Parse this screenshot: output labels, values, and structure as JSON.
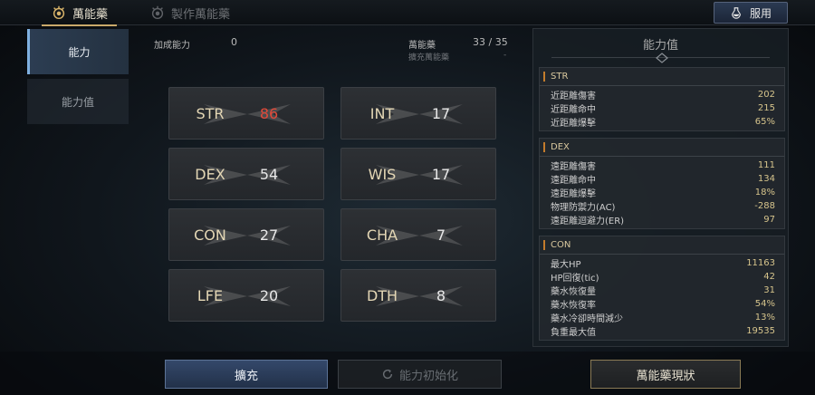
{
  "tabs": [
    {
      "label": "萬能藥",
      "active": true,
      "icon": "elixir-emblem-icon"
    },
    {
      "label": "製作萬能藥",
      "active": false,
      "icon": "craft-emblem-icon"
    }
  ],
  "use_button": {
    "label": "服用",
    "icon": "potion-icon"
  },
  "sidenav": [
    {
      "label": "能力",
      "active": true
    },
    {
      "label": "能力值",
      "active": false
    }
  ],
  "info": {
    "bonus_label": "加成能力",
    "bonus_value": "0",
    "elixir_label": "萬能藥",
    "elixir_value": "33 / 35",
    "expand_label": "擴充萬能藥",
    "expand_value": "-"
  },
  "stats": [
    {
      "name": "STR",
      "value": "86",
      "highlight": true
    },
    {
      "name": "INT",
      "value": "17",
      "highlight": false
    },
    {
      "name": "DEX",
      "value": "54",
      "highlight": false
    },
    {
      "name": "WIS",
      "value": "17",
      "highlight": false
    },
    {
      "name": "CON",
      "value": "27",
      "highlight": false
    },
    {
      "name": "CHA",
      "value": "7",
      "highlight": false
    },
    {
      "name": "LFE",
      "value": "20",
      "highlight": false
    },
    {
      "name": "DTH",
      "value": "8",
      "highlight": false
    }
  ],
  "panel": {
    "title": "能力值",
    "sections": [
      {
        "header": "STR",
        "rows": [
          {
            "label": "近距離傷害",
            "value": "202"
          },
          {
            "label": "近距離命中",
            "value": "215"
          },
          {
            "label": "近距離爆擊",
            "value": "65%"
          }
        ]
      },
      {
        "header": "DEX",
        "rows": [
          {
            "label": "遠距離傷害",
            "value": "111"
          },
          {
            "label": "遠距離命中",
            "value": "134"
          },
          {
            "label": "遠距離爆擊",
            "value": "18%"
          },
          {
            "label": "物理防禦力(AC)",
            "value": "-288"
          },
          {
            "label": "遠距離迴避力(ER)",
            "value": "97"
          }
        ]
      },
      {
        "header": "CON",
        "rows": [
          {
            "label": "最大HP",
            "value": "11163"
          },
          {
            "label": "HP回復(tic)",
            "value": "42"
          },
          {
            "label": "藥水恢復量",
            "value": "31"
          },
          {
            "label": "藥水恢復率",
            "value": "54%"
          },
          {
            "label": "藥水冷卻時間減少",
            "value": "13%"
          },
          {
            "label": "負重最大值",
            "value": "19535"
          }
        ]
      }
    ]
  },
  "buttons": {
    "expand": "擴充",
    "reset": "能力初始化",
    "status": "萬能藥現狀"
  },
  "colors": {
    "accent_gold": "#c9a96a",
    "stat_highlight": "#e14a3a",
    "section_bar": "#c47c2c"
  }
}
